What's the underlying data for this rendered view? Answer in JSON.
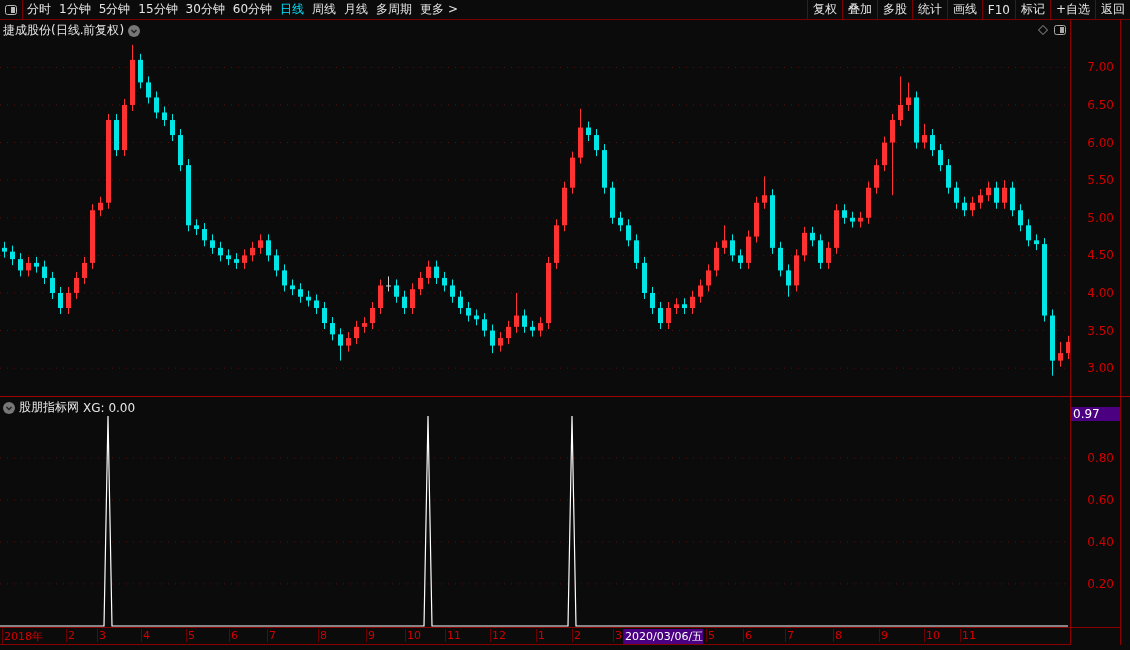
{
  "toolbar": {
    "periods": [
      {
        "label": "分时",
        "selected": false
      },
      {
        "label": "1分钟",
        "selected": false
      },
      {
        "label": "5分钟",
        "selected": false
      },
      {
        "label": "15分钟",
        "selected": false
      },
      {
        "label": "30分钟",
        "selected": false
      },
      {
        "label": "60分钟",
        "selected": false
      },
      {
        "label": "日线",
        "selected": true
      },
      {
        "label": "周线",
        "selected": false
      },
      {
        "label": "月线",
        "selected": false
      },
      {
        "label": "多周期",
        "selected": false
      },
      {
        "label": "更多 >",
        "selected": false
      }
    ],
    "buttons": [
      "复权",
      "叠加",
      "多股",
      "统计",
      "画线",
      "F10",
      "标记",
      "+自选",
      "返回"
    ]
  },
  "price_chart": {
    "title": "捷成股份(日线.前复权)",
    "chart_data": {
      "type": "candlestick",
      "ylim": [
        2.63,
        7.63
      ],
      "grid": true,
      "yticks": [
        {
          "value": 7,
          "label": "7.00"
        },
        {
          "value": 6.5,
          "label": "6.50"
        },
        {
          "value": 6,
          "label": "6.00"
        },
        {
          "value": 5.5,
          "label": "5.50"
        },
        {
          "value": 5,
          "label": "5.00"
        },
        {
          "value": 4.5,
          "label": "4.50"
        },
        {
          "value": 4,
          "label": "4.00"
        },
        {
          "value": 3.5,
          "label": "3.50"
        },
        {
          "value": 3,
          "label": "3.00"
        }
      ],
      "ohlc": [
        [
          4.6,
          4.68,
          4.47,
          4.55
        ],
        [
          4.55,
          4.63,
          4.37,
          4.45
        ],
        [
          4.45,
          4.53,
          4.22,
          4.3
        ],
        [
          4.3,
          4.48,
          4.22,
          4.4
        ],
        [
          4.4,
          4.48,
          4.27,
          4.35
        ],
        [
          4.35,
          4.43,
          4.12,
          4.2
        ],
        [
          4.2,
          4.28,
          3.92,
          4.0
        ],
        [
          4.0,
          4.08,
          3.72,
          3.8
        ],
        [
          3.8,
          4.08,
          3.72,
          4.0
        ],
        [
          4.0,
          4.28,
          3.92,
          4.2
        ],
        [
          4.2,
          4.48,
          4.12,
          4.4
        ],
        [
          4.4,
          5.18,
          4.32,
          5.1
        ],
        [
          5.1,
          5.28,
          5.02,
          5.2
        ],
        [
          5.2,
          6.38,
          5.12,
          6.3
        ],
        [
          6.3,
          6.38,
          5.82,
          5.9
        ],
        [
          5.9,
          6.58,
          5.82,
          6.5
        ],
        [
          6.5,
          7.3,
          6.42,
          7.1
        ],
        [
          7.1,
          7.18,
          6.72,
          6.8
        ],
        [
          6.8,
          6.88,
          6.52,
          6.6
        ],
        [
          6.6,
          6.68,
          6.32,
          6.4
        ],
        [
          6.4,
          6.48,
          6.22,
          6.3
        ],
        [
          6.3,
          6.38,
          6.02,
          6.1
        ],
        [
          6.1,
          6.18,
          5.62,
          5.7
        ],
        [
          5.7,
          5.78,
          4.82,
          4.9
        ],
        [
          4.9,
          4.98,
          4.77,
          4.85
        ],
        [
          4.85,
          4.93,
          4.62,
          4.7
        ],
        [
          4.7,
          4.78,
          4.52,
          4.6
        ],
        [
          4.6,
          4.68,
          4.42,
          4.5
        ],
        [
          4.5,
          4.58,
          4.37,
          4.45
        ],
        [
          4.45,
          4.53,
          4.32,
          4.4
        ],
        [
          4.4,
          4.58,
          4.32,
          4.5
        ],
        [
          4.5,
          4.68,
          4.42,
          4.6
        ],
        [
          4.6,
          4.78,
          4.52,
          4.7
        ],
        [
          4.7,
          4.78,
          4.42,
          4.5
        ],
        [
          4.5,
          4.58,
          4.22,
          4.3
        ],
        [
          4.3,
          4.38,
          4.02,
          4.1
        ],
        [
          4.1,
          4.18,
          3.97,
          4.05
        ],
        [
          4.05,
          4.13,
          3.87,
          3.95
        ],
        [
          3.95,
          4.03,
          3.82,
          3.9
        ],
        [
          3.9,
          3.98,
          3.72,
          3.8
        ],
        [
          3.8,
          3.88,
          3.52,
          3.6
        ],
        [
          3.6,
          3.68,
          3.37,
          3.45
        ],
        [
          3.45,
          3.53,
          3.1,
          3.3
        ],
        [
          3.3,
          3.48,
          3.22,
          3.4
        ],
        [
          3.4,
          3.63,
          3.32,
          3.55
        ],
        [
          3.55,
          3.68,
          3.47,
          3.6
        ],
        [
          3.6,
          3.88,
          3.52,
          3.8
        ],
        [
          3.8,
          4.18,
          3.72,
          4.1
        ],
        [
          4.1,
          4.22,
          4.02,
          4.1
        ],
        [
          4.1,
          4.18,
          3.87,
          3.95
        ],
        [
          3.95,
          4.03,
          3.72,
          3.8
        ],
        [
          3.8,
          4.13,
          3.72,
          4.05
        ],
        [
          4.05,
          4.28,
          3.97,
          4.2
        ],
        [
          4.2,
          4.43,
          4.12,
          4.35
        ],
        [
          4.35,
          4.43,
          4.12,
          4.2
        ],
        [
          4.2,
          4.28,
          4.02,
          4.1
        ],
        [
          4.1,
          4.18,
          3.87,
          3.95
        ],
        [
          3.95,
          4.03,
          3.72,
          3.8
        ],
        [
          3.8,
          3.88,
          3.62,
          3.7
        ],
        [
          3.7,
          3.78,
          3.57,
          3.65
        ],
        [
          3.65,
          3.73,
          3.42,
          3.5
        ],
        [
          3.5,
          3.58,
          3.2,
          3.3
        ],
        [
          3.3,
          3.48,
          3.22,
          3.4
        ],
        [
          3.4,
          3.63,
          3.32,
          3.55
        ],
        [
          3.55,
          4.0,
          3.47,
          3.7
        ],
        [
          3.7,
          3.78,
          3.47,
          3.55
        ],
        [
          3.55,
          3.63,
          3.42,
          3.5
        ],
        [
          3.5,
          3.68,
          3.42,
          3.6
        ],
        [
          3.6,
          4.48,
          3.52,
          4.4
        ],
        [
          4.4,
          4.98,
          4.32,
          4.9
        ],
        [
          4.9,
          5.48,
          4.82,
          5.4
        ],
        [
          5.4,
          5.88,
          5.32,
          5.8
        ],
        [
          5.8,
          6.45,
          5.72,
          6.2
        ],
        [
          6.2,
          6.28,
          6.02,
          6.1
        ],
        [
          6.1,
          6.18,
          5.82,
          5.9
        ],
        [
          5.9,
          5.98,
          5.32,
          5.4
        ],
        [
          5.4,
          5.48,
          4.92,
          5.0
        ],
        [
          5.0,
          5.08,
          4.82,
          4.9
        ],
        [
          4.9,
          4.98,
          4.62,
          4.7
        ],
        [
          4.7,
          4.78,
          4.32,
          4.4
        ],
        [
          4.4,
          4.48,
          3.92,
          4.0
        ],
        [
          4.0,
          4.08,
          3.72,
          3.8
        ],
        [
          3.8,
          3.88,
          3.52,
          3.6
        ],
        [
          3.6,
          3.88,
          3.52,
          3.8
        ],
        [
          3.8,
          3.93,
          3.72,
          3.85
        ],
        [
          3.85,
          3.93,
          3.72,
          3.8
        ],
        [
          3.8,
          4.03,
          3.72,
          3.95
        ],
        [
          3.95,
          4.18,
          3.87,
          4.1
        ],
        [
          4.1,
          4.38,
          4.02,
          4.3
        ],
        [
          4.3,
          4.68,
          4.22,
          4.6
        ],
        [
          4.6,
          4.9,
          4.52,
          4.7
        ],
        [
          4.7,
          4.78,
          4.42,
          4.5
        ],
        [
          4.5,
          4.58,
          4.32,
          4.4
        ],
        [
          4.4,
          4.83,
          4.32,
          4.75
        ],
        [
          4.75,
          5.28,
          4.67,
          5.2
        ],
        [
          5.2,
          5.55,
          5.12,
          5.3
        ],
        [
          5.3,
          5.38,
          4.52,
          4.6
        ],
        [
          4.6,
          4.68,
          4.22,
          4.3
        ],
        [
          4.3,
          4.38,
          3.95,
          4.1
        ],
        [
          4.1,
          4.58,
          4.02,
          4.5
        ],
        [
          4.5,
          4.88,
          4.42,
          4.8
        ],
        [
          4.8,
          4.88,
          4.62,
          4.7
        ],
        [
          4.7,
          4.78,
          4.32,
          4.4
        ],
        [
          4.4,
          4.68,
          4.32,
          4.6
        ],
        [
          4.6,
          5.18,
          4.52,
          5.1
        ],
        [
          5.1,
          5.18,
          4.92,
          5.0
        ],
        [
          5.0,
          5.08,
          4.87,
          4.95
        ],
        [
          4.95,
          5.08,
          4.87,
          5.0
        ],
        [
          5.0,
          5.48,
          4.92,
          5.4
        ],
        [
          5.4,
          5.78,
          5.32,
          5.7
        ],
        [
          5.7,
          6.08,
          5.62,
          6.0
        ],
        [
          6.0,
          6.38,
          5.3,
          6.3
        ],
        [
          6.3,
          6.88,
          6.22,
          6.5
        ],
        [
          6.5,
          6.8,
          6.42,
          6.6
        ],
        [
          6.6,
          6.68,
          5.92,
          6.0
        ],
        [
          6.0,
          6.25,
          5.92,
          6.1
        ],
        [
          6.1,
          6.18,
          5.82,
          5.9
        ],
        [
          5.9,
          5.98,
          5.62,
          5.7
        ],
        [
          5.7,
          5.78,
          5.32,
          5.4
        ],
        [
          5.4,
          5.48,
          5.12,
          5.2
        ],
        [
          5.2,
          5.28,
          5.02,
          5.1
        ],
        [
          5.1,
          5.28,
          5.02,
          5.2
        ],
        [
          5.2,
          5.38,
          5.12,
          5.3
        ],
        [
          5.3,
          5.48,
          5.22,
          5.4
        ],
        [
          5.4,
          5.48,
          5.12,
          5.2
        ],
        [
          5.2,
          5.5,
          5.12,
          5.4
        ],
        [
          5.4,
          5.48,
          5.02,
          5.1
        ],
        [
          5.1,
          5.18,
          4.82,
          4.9
        ],
        [
          4.9,
          4.98,
          4.62,
          4.7
        ],
        [
          4.7,
          4.78,
          4.57,
          4.65
        ],
        [
          4.65,
          4.73,
          3.62,
          3.7
        ],
        [
          3.7,
          3.78,
          2.9,
          3.1
        ],
        [
          3.1,
          3.35,
          3.02,
          3.2
        ],
        [
          3.2,
          3.43,
          3.12,
          3.35
        ]
      ]
    }
  },
  "indicator": {
    "name": "股朋指标网",
    "value": "XG: 0.00",
    "current": "0.97",
    "chart_data": {
      "type": "line",
      "ylim": [
        0,
        1.09
      ],
      "grid": true,
      "yticks": [
        {
          "value": 0.8,
          "label": "0.80"
        },
        {
          "value": 0.6,
          "label": "0.60"
        },
        {
          "value": 0.4,
          "label": "0.40"
        },
        {
          "value": 0.2,
          "label": "0.20"
        }
      ],
      "series": [
        {
          "color": "#ffffff",
          "values": [
            0,
            0,
            0,
            0,
            0,
            0,
            0,
            0,
            0,
            0,
            0,
            0,
            0,
            0,
            0,
            0,
            0,
            0,
            0,
            0,
            0,
            0,
            0,
            0,
            0,
            0,
            0,
            1,
            0,
            0,
            0,
            0,
            0,
            0,
            0,
            0,
            0,
            0,
            0,
            0,
            0,
            0,
            0,
            0,
            0,
            0,
            0,
            0,
            0,
            0,
            0,
            0,
            0,
            0,
            0,
            0,
            0,
            0,
            0,
            0,
            0,
            0,
            0,
            0,
            0,
            0,
            0,
            0,
            0,
            0,
            0,
            0,
            0,
            0,
            0,
            0,
            0,
            0,
            0,
            0,
            0,
            0,
            0,
            0,
            0,
            0,
            0,
            0,
            0,
            0,
            0,
            0,
            0,
            0,
            0,
            0,
            0,
            0,
            0,
            0,
            0,
            0,
            0,
            0,
            0,
            0,
            0,
            1,
            0,
            0,
            0,
            0,
            0,
            0,
            0,
            0,
            0,
            0,
            0,
            0,
            0,
            0,
            0,
            0,
            0,
            0,
            0,
            0,
            0,
            0,
            0,
            0,
            0,
            0,
            0,
            0,
            0,
            0,
            0,
            0,
            0,
            0,
            0,
            1,
            0,
            0,
            0,
            0,
            0,
            0,
            0,
            0,
            0,
            0,
            0,
            0,
            0,
            0,
            0,
            0,
            0,
            0,
            0,
            0,
            0,
            0,
            0,
            0,
            0,
            0,
            0,
            0,
            0,
            0,
            0,
            0,
            0,
            0,
            0,
            0,
            0,
            0,
            0,
            0,
            0,
            0,
            0,
            0,
            0,
            0,
            0,
            0,
            0,
            0,
            0,
            0,
            0,
            0,
            0,
            0,
            0,
            0,
            0,
            0,
            0,
            0,
            0,
            0,
            0,
            0,
            0,
            0,
            0,
            0,
            0,
            0,
            0,
            0,
            0,
            0,
            0,
            0,
            0,
            0,
            0,
            0,
            0,
            0,
            0,
            0,
            0,
            0,
            0,
            0,
            0,
            0,
            0,
            0,
            0,
            0,
            0,
            0,
            0,
            0,
            0,
            0,
            0,
            0,
            0,
            0,
            0,
            0,
            0,
            0,
            0,
            0,
            0,
            0,
            0,
            0,
            0,
            0,
            0,
            0,
            0,
            0,
            0,
            0
          ]
        }
      ]
    }
  },
  "date_axis": [
    {
      "label": "2018年",
      "highlighted": false
    },
    {
      "label": "2",
      "highlighted": false
    },
    {
      "label": "3",
      "highlighted": false
    },
    {
      "label": "4",
      "highlighted": false
    },
    {
      "label": "5",
      "highlighted": false
    },
    {
      "label": "6",
      "highlighted": false
    },
    {
      "label": "7",
      "highlighted": false
    },
    {
      "label": "8",
      "highlighted": false
    },
    {
      "label": "9",
      "highlighted": false
    },
    {
      "label": "10",
      "highlighted": false
    },
    {
      "label": "11",
      "highlighted": false
    },
    {
      "label": "12",
      "highlighted": false
    },
    {
      "label": "1",
      "highlighted": false
    },
    {
      "label": "2",
      "highlighted": false
    },
    {
      "label": "3",
      "highlighted": false
    },
    {
      "label": "2020/03/06/五",
      "highlighted": true
    },
    {
      "label": "5",
      "highlighted": false
    },
    {
      "label": "6",
      "highlighted": false
    },
    {
      "label": "7",
      "highlighted": false
    },
    {
      "label": "8",
      "highlighted": false
    },
    {
      "label": "9",
      "highlighted": false
    },
    {
      "label": "10",
      "highlighted": false
    },
    {
      "label": "11",
      "highlighted": false
    }
  ]
}
